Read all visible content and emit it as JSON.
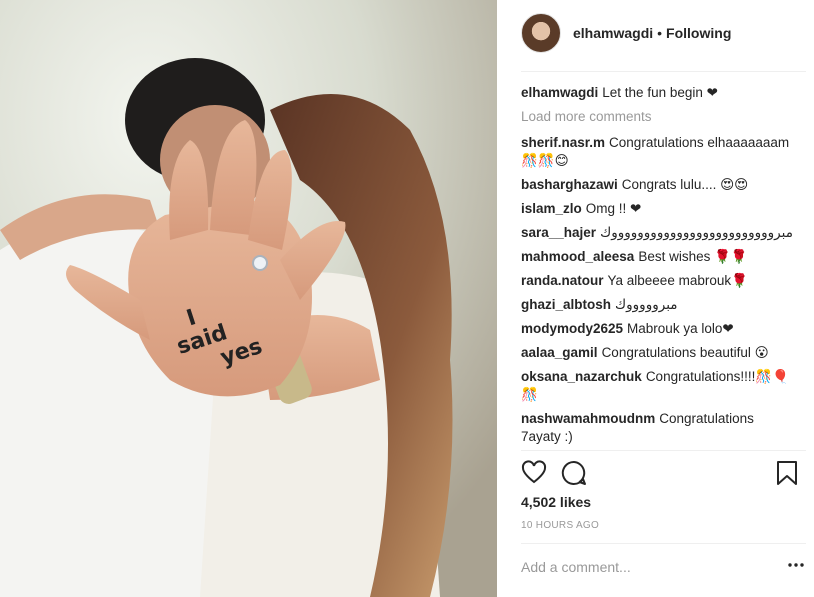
{
  "post": {
    "username": "elhamwagdi",
    "separator": "•",
    "follow_label": "Following",
    "caption": {
      "user": "elhamwagdi",
      "text": "Let the fun begin ❤"
    },
    "load_more": "Load more comments",
    "photo_hand_text": [
      "I",
      "said",
      "yes"
    ]
  },
  "comments": [
    {
      "user": "sherif.nasr.m",
      "text": "Congratulations elhaaaaaaam 🎊🎊😊"
    },
    {
      "user": "basharghazawi",
      "text": "Congrats lulu.... 😍😍"
    },
    {
      "user": "islam_zlo",
      "text": "Omg !! ❤"
    },
    {
      "user": "sara__hajer",
      "text": "مبروووووووووووووووووووووووووك"
    },
    {
      "user": "mahmood_aleesa",
      "text": "Best wishes 🌹🌹"
    },
    {
      "user": "randa.natour",
      "text": "Ya albeeee mabrouk🌹"
    },
    {
      "user": "ghazi_albtosh",
      "text": "مبروووووك"
    },
    {
      "user": "modymody2625",
      "text": "Mabrouk ya lolo❤"
    },
    {
      "user": "aalaa_gamil",
      "text": "Congratulations beautiful 😮"
    },
    {
      "user": "oksana_nazarchuk",
      "text": "Congratulations!!!!🎊🎈🎊"
    },
    {
      "user": "nashwamahmoudnm",
      "text": "Congratulations 7ayaty :)"
    }
  ],
  "actions": {
    "like_icon": "heart-outline",
    "comment_icon": "speech-bubble",
    "save_icon": "bookmark"
  },
  "likes": "4,502 likes",
  "timestamp": "10 HOURS AGO",
  "add_comment": {
    "placeholder": "Add a comment..."
  },
  "more_icon": "ellipsis",
  "colors": {
    "text": "#262626",
    "muted": "#999999",
    "divider": "#efefef",
    "heart": "#111111"
  }
}
